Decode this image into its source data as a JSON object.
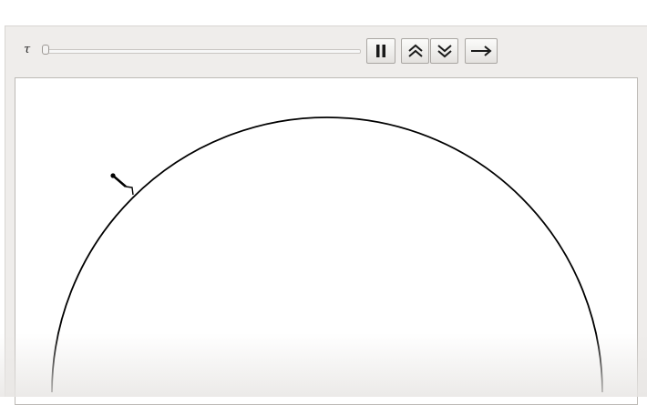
{
  "controls": {
    "parameter_label": "τ",
    "slider_value": 0.0,
    "buttons": [
      {
        "name": "pause",
        "icon": "pause-icon"
      },
      {
        "name": "faster",
        "icon": "double-chevron-up-icon"
      },
      {
        "name": "slower",
        "icon": "double-chevron-down-icon"
      },
      {
        "name": "direction",
        "icon": "arrow-right-icon"
      }
    ]
  },
  "graphic": {
    "stroke_color": "#000000",
    "background": "#ffffff"
  }
}
